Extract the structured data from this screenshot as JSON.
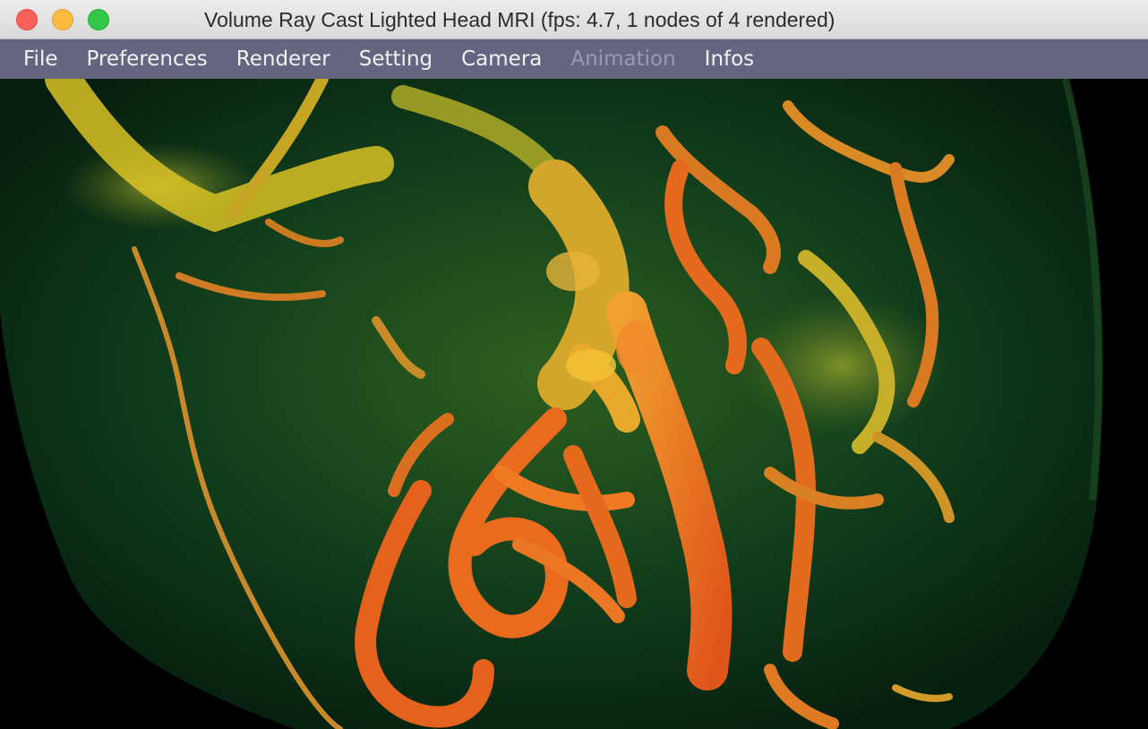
{
  "window": {
    "title": "Volume Ray Cast Lighted Head MRI (fps:  4.7, 1 nodes of 4 rendered)"
  },
  "menubar": {
    "items": [
      {
        "label": "File",
        "enabled": true
      },
      {
        "label": "Preferences",
        "enabled": true
      },
      {
        "label": "Renderer",
        "enabled": true
      },
      {
        "label": "Setting",
        "enabled": true
      },
      {
        "label": "Camera",
        "enabled": true
      },
      {
        "label": "Animation",
        "enabled": false
      },
      {
        "label": "Infos",
        "enabled": true
      }
    ]
  },
  "colors": {
    "tissue": "#0f3d1a",
    "vessel_orange": "#e8661e",
    "vessel_yellow": "#d6b821",
    "menubar_bg": "#6e6e8c",
    "disabled_text": "#9a9aae"
  }
}
